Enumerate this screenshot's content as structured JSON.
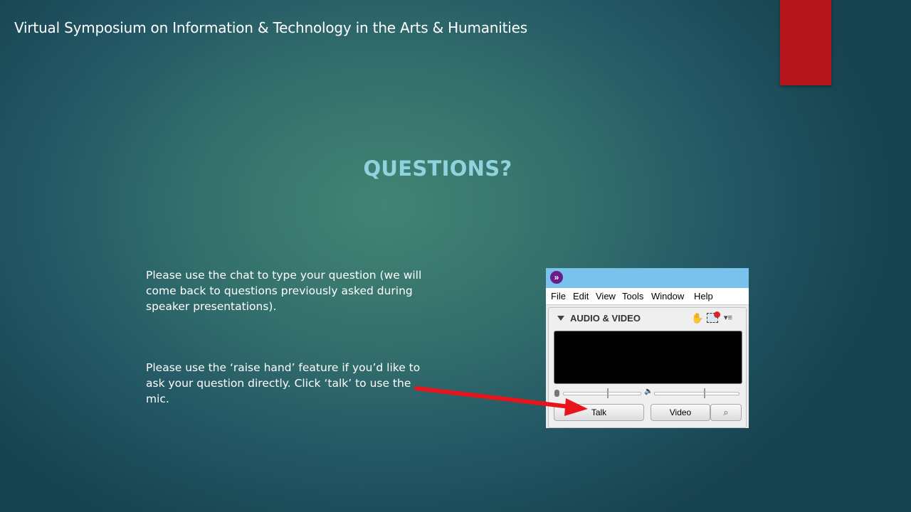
{
  "header": {
    "title": "Virtual Symposium on Information & Technology in the Arts & Humanities"
  },
  "slide": {
    "title": "QUESTIONS?",
    "paragraphs": [
      "Please use the chat to type your question (we will come back to questions previously asked during speaker presentations).",
      "Please use the ‘raise hand’ feature if you’d like to ask your question directly. Click ‘talk’ to use the mic."
    ]
  },
  "screenshot": {
    "logo_glyph": "»",
    "menu": [
      "File",
      "Edit",
      "View",
      "Tools",
      "Window",
      "Help"
    ],
    "panel_title": "AUDIO & VIDEO",
    "options_glyph": "▾≡",
    "buttons": {
      "talk": "Talk",
      "video": "Video",
      "search_glyph": "⌕"
    },
    "icons": {
      "hand": "raise-hand-icon",
      "settings": "audio-settings-icon",
      "mic": "microphone-icon",
      "speaker": "speaker-icon"
    }
  },
  "colors": {
    "background_center": "#438574",
    "background_edge": "#17424f",
    "accent_tab": "#b4161b",
    "title_color": "#8fd3de",
    "arrow": "#e8141c",
    "app_titlebar": "#79c2ec"
  }
}
